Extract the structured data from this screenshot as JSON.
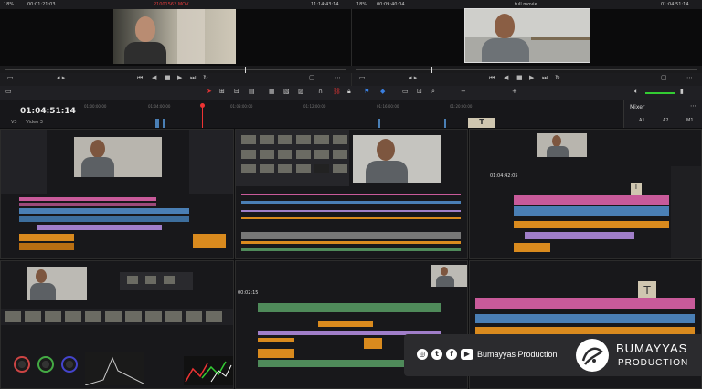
{
  "source_viewer": {
    "zoom": "18%",
    "timecode_left": "00:01:21:03",
    "clip_name": "P1001562.MOV",
    "timecode_right": "11:14:43:14"
  },
  "timeline_viewer": {
    "zoom": "18%",
    "timecode_left": "00:09:40:04",
    "timeline_name": "full movie",
    "timecode_right": "01:04:51:14"
  },
  "timeline": {
    "current_timecode": "01:04:51:14",
    "track_name": "V3",
    "track_label": "Video 3",
    "ruler_ticks": [
      "01:00:00:00",
      "01:04:00:00",
      "01:08:00:00",
      "01:12:00:00",
      "01:16:00:00",
      "01:20:00:00"
    ]
  },
  "mixer": {
    "title": "Mixer",
    "channels": [
      "A1",
      "A2",
      "M1"
    ]
  },
  "tile_timecode_right": "01:04:42:05",
  "tile_timecode_left": "00:02:15",
  "title_card_letter": "T",
  "branding": {
    "social_name": "Bumayyas Production",
    "brand_line1": "BUMAYYAS",
    "brand_line2": "PRODUCTION",
    "social_icons": [
      "instagram-icon",
      "twitter-icon",
      "facebook-icon",
      "youtube-icon"
    ]
  },
  "colors": {
    "pink_clip": "#c85a9a",
    "blue_clip": "#4a7fb5",
    "purple_clip": "#a07ec9",
    "orange_clip": "#d98a1e",
    "green_clip": "#4f8a5a",
    "red_clip_name": "#e03a3a"
  }
}
